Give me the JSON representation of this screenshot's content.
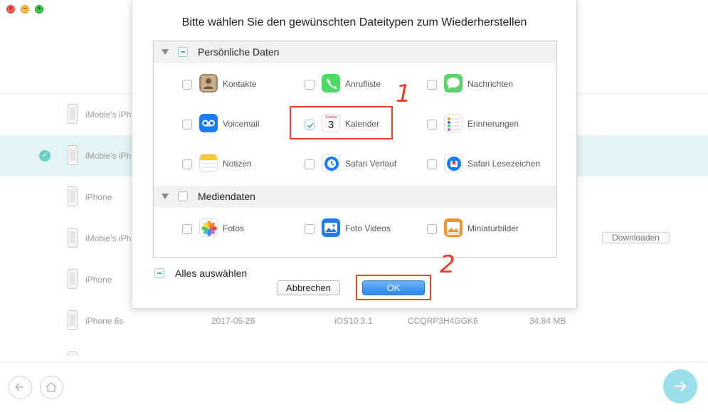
{
  "window": {
    "controls": [
      "close",
      "minimize",
      "zoom"
    ]
  },
  "dialog": {
    "title": "Bitte wählen Sie den gewünschten Dateitypen zum Wiederherstellen",
    "sections": [
      {
        "label": "Persönliche Daten",
        "state": "partial",
        "items": [
          {
            "label": "Kontakte",
            "icon": "contacts-icon",
            "checked": false
          },
          {
            "label": "Anrufliste",
            "icon": "phone-icon",
            "checked": false
          },
          {
            "label": "Nachrichten",
            "icon": "messages-icon",
            "checked": false
          },
          {
            "label": "Voicemail",
            "icon": "voicemail-icon",
            "checked": false
          },
          {
            "label": "Kalender",
            "icon": "calendar-icon",
            "checked": true,
            "icon_day": "3",
            "icon_weekday": "Sunday"
          },
          {
            "label": "Erinnerungen",
            "icon": "reminders-icon",
            "checked": false
          },
          {
            "label": "Notizen",
            "icon": "notes-icon",
            "checked": false
          },
          {
            "label": "Safari Verlauf",
            "icon": "safari-history-icon",
            "checked": false
          },
          {
            "label": "Safari Lesezeichen",
            "icon": "safari-bookmarks-icon",
            "checked": false
          }
        ]
      },
      {
        "label": "Mediendaten",
        "state": "unchecked",
        "items": [
          {
            "label": "Fotos",
            "icon": "photos-icon",
            "checked": false
          },
          {
            "label": "Foto Videos",
            "icon": "photo-videos-icon",
            "checked": false
          },
          {
            "label": "Miniaturbilder",
            "icon": "thumbnails-icon",
            "checked": false
          }
        ]
      }
    ],
    "select_all_label": "Alles auswählen",
    "cancel_label": "Abbrechen",
    "ok_label": "OK"
  },
  "annotations": {
    "step1": "1",
    "step2": "2"
  },
  "background": {
    "devices": [
      {
        "name": "iMobie's iPh",
        "selected": false
      },
      {
        "name": "iMobie's iPh",
        "selected": true
      },
      {
        "name": "iPhone",
        "selected": false
      },
      {
        "name": "iMobie's iPh",
        "selected": false,
        "action": "Downloaden"
      },
      {
        "name": "iPhone",
        "selected": false
      },
      {
        "name": "iPhone 6s",
        "selected": false,
        "date": "2017-05-26",
        "ios": "iOS10.3.1",
        "serial": "CCQRP3H4GGK6",
        "size": "34.84 MB"
      }
    ]
  },
  "colors": {
    "accent": "#2b86f0",
    "annotation": "#e8412e",
    "selection": "#e3f3f6",
    "teal": "#6dcfc1"
  }
}
